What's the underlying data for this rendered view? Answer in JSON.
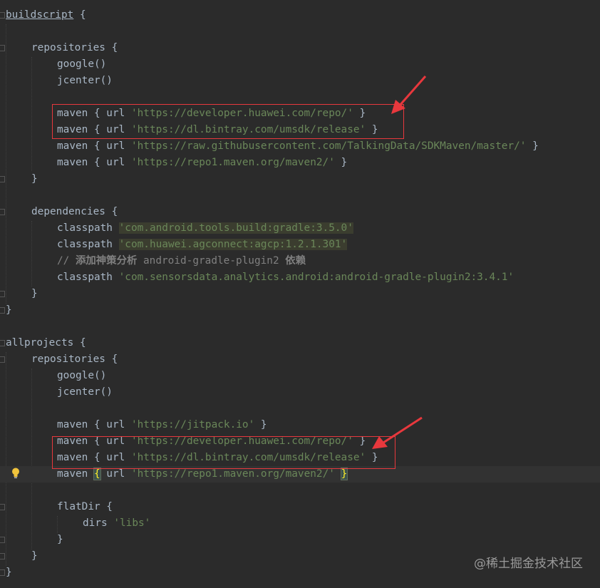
{
  "editor": {
    "lines": [
      {
        "row": 0,
        "indent": 0,
        "parts": [
          {
            "t": "buildscript",
            "c": "link"
          },
          {
            "t": " {",
            "c": "kw"
          }
        ]
      },
      {
        "row": 1,
        "indent": 0,
        "parts": []
      },
      {
        "row": 2,
        "indent": 1,
        "parts": [
          {
            "t": "repositories {",
            "c": "kw"
          }
        ]
      },
      {
        "row": 3,
        "indent": 2,
        "parts": [
          {
            "t": "google()",
            "c": "kw"
          }
        ]
      },
      {
        "row": 4,
        "indent": 2,
        "parts": [
          {
            "t": "jcenter()",
            "c": "kw"
          }
        ]
      },
      {
        "row": 5,
        "indent": 0,
        "parts": []
      },
      {
        "row": 6,
        "indent": 2,
        "parts": [
          {
            "t": "maven { url ",
            "c": "kw"
          },
          {
            "t": "'https://developer.huawei.com/repo/'",
            "c": "str"
          },
          {
            "t": " }",
            "c": "kw"
          }
        ]
      },
      {
        "row": 7,
        "indent": 2,
        "parts": [
          {
            "t": "maven { url ",
            "c": "kw"
          },
          {
            "t": "'https://dl.bintray.com/umsdk/release'",
            "c": "str"
          },
          {
            "t": " }",
            "c": "kw"
          }
        ]
      },
      {
        "row": 8,
        "indent": 2,
        "parts": [
          {
            "t": "maven { url ",
            "c": "kw"
          },
          {
            "t": "'https://raw.githubusercontent.com/TalkingData/SDKMaven/master/'",
            "c": "str"
          },
          {
            "t": " }",
            "c": "kw"
          }
        ]
      },
      {
        "row": 9,
        "indent": 2,
        "parts": [
          {
            "t": "maven { url ",
            "c": "kw"
          },
          {
            "t": "'https://repo1.maven.org/maven2/'",
            "c": "str"
          },
          {
            "t": " }",
            "c": "kw"
          }
        ]
      },
      {
        "row": 10,
        "indent": 1,
        "parts": [
          {
            "t": "}",
            "c": "kw"
          }
        ]
      },
      {
        "row": 11,
        "indent": 0,
        "parts": []
      },
      {
        "row": 12,
        "indent": 1,
        "parts": [
          {
            "t": "dependencies {",
            "c": "kw"
          }
        ]
      },
      {
        "row": 13,
        "indent": 2,
        "parts": [
          {
            "t": "classpath ",
            "c": "kw"
          },
          {
            "t": "'com.android.tools.build:gradle:3.5.0'",
            "c": "str hl"
          }
        ]
      },
      {
        "row": 14,
        "indent": 2,
        "parts": [
          {
            "t": "classpath ",
            "c": "kw"
          },
          {
            "t": "'com.huawei.agconnect:agcp:1.2.1.301'",
            "c": "str hl"
          }
        ]
      },
      {
        "row": 15,
        "indent": 2,
        "parts": [
          {
            "t": "// ",
            "c": "cm"
          },
          {
            "t": "添加神策分析",
            "c": "cm-bold"
          },
          {
            "t": " android-gradle-plugin2 ",
            "c": "cm"
          },
          {
            "t": "依赖",
            "c": "cm-bold"
          }
        ]
      },
      {
        "row": 16,
        "indent": 2,
        "parts": [
          {
            "t": "classpath ",
            "c": "kw"
          },
          {
            "t": "'com.sensorsdata.analytics.android:android-gradle-plugin2:3.4.1'",
            "c": "str"
          }
        ]
      },
      {
        "row": 17,
        "indent": 1,
        "parts": [
          {
            "t": "}",
            "c": "kw"
          }
        ]
      },
      {
        "row": 18,
        "indent": 0,
        "parts": [
          {
            "t": "}",
            "c": "kw"
          }
        ]
      },
      {
        "row": 19,
        "indent": 0,
        "parts": []
      },
      {
        "row": 20,
        "indent": 0,
        "parts": [
          {
            "t": "allprojects {",
            "c": "kw"
          }
        ]
      },
      {
        "row": 21,
        "indent": 1,
        "parts": [
          {
            "t": "repositories {",
            "c": "kw"
          }
        ]
      },
      {
        "row": 22,
        "indent": 2,
        "parts": [
          {
            "t": "google()",
            "c": "kw"
          }
        ]
      },
      {
        "row": 23,
        "indent": 2,
        "parts": [
          {
            "t": "jcenter()",
            "c": "kw"
          }
        ]
      },
      {
        "row": 24,
        "indent": 0,
        "parts": []
      },
      {
        "row": 25,
        "indent": 2,
        "parts": [
          {
            "t": "maven { url ",
            "c": "kw"
          },
          {
            "t": "'https://jitpack.io'",
            "c": "str"
          },
          {
            "t": " }",
            "c": "kw"
          }
        ]
      },
      {
        "row": 26,
        "indent": 2,
        "parts": [
          {
            "t": "maven { url ",
            "c": "kw"
          },
          {
            "t": "'https://developer.huawei.com/repo/'",
            "c": "str"
          },
          {
            "t": " }",
            "c": "kw"
          }
        ]
      },
      {
        "row": 27,
        "indent": 2,
        "parts": [
          {
            "t": "maven { url ",
            "c": "kw"
          },
          {
            "t": "'https://dl.bintray.com/umsdk/release'",
            "c": "str"
          },
          {
            "t": " }",
            "c": "kw"
          }
        ]
      },
      {
        "row": 28,
        "indent": 2,
        "caret": true,
        "parts": [
          {
            "t": "maven ",
            "c": "kw"
          },
          {
            "t": "{",
            "c": "brace-hl"
          },
          {
            "t": " url ",
            "c": "kw"
          },
          {
            "t": "'https://repo1.maven.org/maven2/'",
            "c": "str"
          },
          {
            "t": " ",
            "c": "kw"
          },
          {
            "t": "}",
            "c": "brace-hl"
          }
        ]
      },
      {
        "row": 29,
        "indent": 0,
        "parts": []
      },
      {
        "row": 30,
        "indent": 2,
        "parts": [
          {
            "t": "flatDir {",
            "c": "kw"
          }
        ]
      },
      {
        "row": 31,
        "indent": 3,
        "parts": [
          {
            "t": "dirs ",
            "c": "kw"
          },
          {
            "t": "'libs'",
            "c": "str"
          }
        ]
      },
      {
        "row": 32,
        "indent": 2,
        "parts": [
          {
            "t": "}",
            "c": "kw"
          }
        ]
      },
      {
        "row": 33,
        "indent": 1,
        "parts": [
          {
            "t": "}",
            "c": "kw"
          }
        ]
      },
      {
        "row": 34,
        "indent": 0,
        "parts": [
          {
            "t": "}",
            "c": "kw"
          }
        ]
      }
    ]
  },
  "annotations": {
    "box_color": "#e8383d"
  },
  "watermark": {
    "text": "@稀土掘金技术社区"
  }
}
